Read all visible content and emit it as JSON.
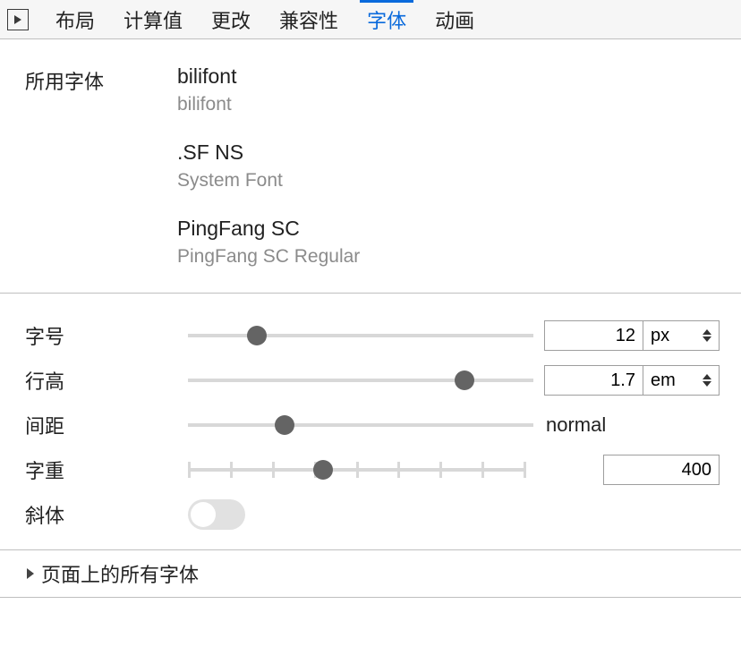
{
  "tabs": {
    "t0": "布局",
    "t1": "计算值",
    "t2": "更改",
    "t3": "兼容性",
    "t4": "字体",
    "t5": "动画"
  },
  "labels": {
    "fontsUsed": "所用字体",
    "fontSize": "字号",
    "lineHeight": "行高",
    "spacing": "间距",
    "weight": "字重",
    "italic": "斜体"
  },
  "fonts": [
    {
      "name": "bilifont",
      "sub": "bilifont"
    },
    {
      "name": ".SF NS",
      "sub": "System Font"
    },
    {
      "name": "PingFang SC",
      "sub": "PingFang SC Regular"
    }
  ],
  "controls": {
    "fontSize": {
      "value": "12",
      "unit": "px",
      "pos": 20
    },
    "lineHeight": {
      "value": "1.7",
      "unit": "em",
      "pos": 80
    },
    "spacing": {
      "text": "normal",
      "pos": 28
    },
    "weight": {
      "value": "400",
      "pos": 40
    },
    "italic": {
      "on": false
    }
  },
  "section": {
    "allFonts": "页面上的所有字体"
  }
}
